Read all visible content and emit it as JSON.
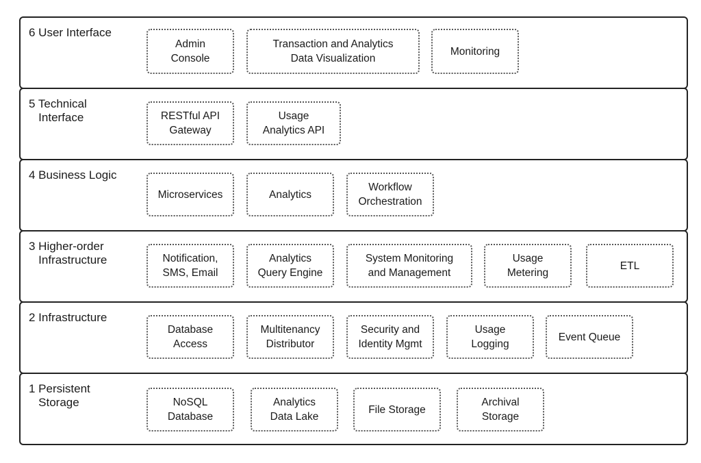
{
  "diagram": {
    "type": "layered-architecture",
    "layers": [
      {
        "number": "6",
        "label": "6 User Interface",
        "components": [
          "Admin\nConsole",
          "Transaction and Analytics\nData Visualization",
          "Monitoring"
        ]
      },
      {
        "number": "5",
        "label": "5 Technical\n   Interface",
        "components": [
          "RESTful API\nGateway",
          "Usage\nAnalytics API"
        ]
      },
      {
        "number": "4",
        "label": "4 Business Logic",
        "components": [
          "Microservices",
          "Analytics",
          "Workflow\nOrchestration"
        ]
      },
      {
        "number": "3",
        "label": "3 Higher-order\n   Infrastructure",
        "components": [
          "Notification,\nSMS, Email",
          "Analytics\nQuery Engine",
          "System Monitoring\nand Management",
          "Usage\nMetering",
          "ETL"
        ]
      },
      {
        "number": "2",
        "label": "2 Infrastructure",
        "components": [
          "Database\nAccess",
          "Multitenancy\nDistributor",
          "Security and\nIdentity Mgmt",
          "Usage\nLogging",
          "Event Queue"
        ]
      },
      {
        "number": "1",
        "label": "1 Persistent\n   Storage",
        "components": [
          "NoSQL\nDatabase",
          "Analytics\nData Lake",
          "File Storage",
          "Archival\nStorage"
        ]
      }
    ]
  }
}
